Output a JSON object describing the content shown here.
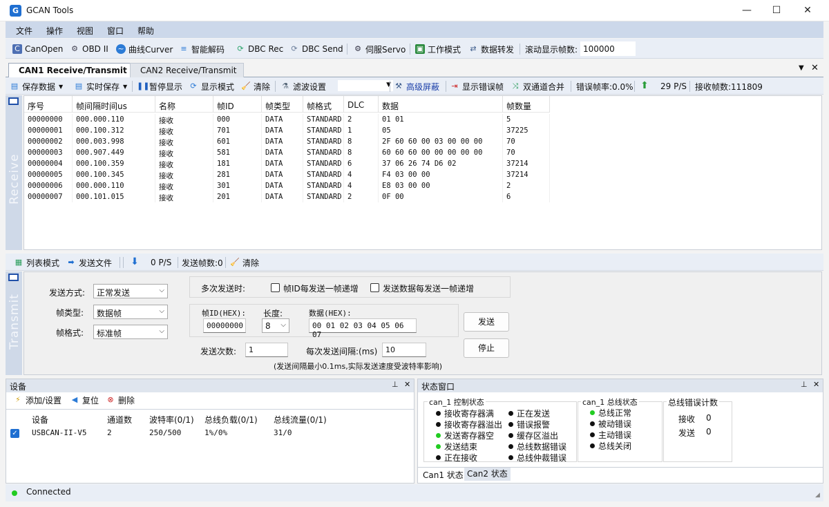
{
  "window": {
    "title": "GCAN Tools",
    "minimize": "—",
    "maximize": "☐",
    "close": "✕"
  },
  "menu": [
    "文件",
    "操作",
    "视图",
    "窗口",
    "帮助"
  ],
  "toolbar1": {
    "items": [
      "CanOpen",
      "OBD II",
      "曲线Curver",
      "智能解码",
      "DBC Rec",
      "DBC Send",
      "伺服Servo",
      "工作模式",
      "数据转发"
    ],
    "scroll_label": "滚动显示帧数:",
    "scroll_value": "100000"
  },
  "tabs": [
    "CAN1 Receive/Transmit",
    "CAN2 Receive/Transmit"
  ],
  "toolbar2": {
    "save_data": "保存数据",
    "realtime_save": "实时保存",
    "pause": "暂停显示",
    "display_mode": "显示模式",
    "clear": "清除",
    "filter_settings": "滤波设置",
    "advanced_mask": "高级屏蔽",
    "show_error_frames": "显示错误帧",
    "dual_merge": "双通道合并",
    "error_rate": "错误帧率:0.0%",
    "rate": "29 P/S",
    "received": "接收帧数:111809"
  },
  "receive": {
    "side_label": "Receive",
    "columns": [
      "序号",
      "帧间隔时间us",
      "名称",
      "帧ID",
      "帧类型",
      "帧格式",
      "DLC",
      "数据",
      "帧数量"
    ],
    "rows": [
      [
        "00000000",
        "000.000.110",
        "接收",
        "000",
        "DATA",
        "STANDARD",
        "2",
        "01 01",
        "5"
      ],
      [
        "00000001",
        "000.100.312",
        "接收",
        "701",
        "DATA",
        "STANDARD",
        "1",
        "05",
        "37225"
      ],
      [
        "00000002",
        "000.003.998",
        "接收",
        "601",
        "DATA",
        "STANDARD",
        "8",
        "2F 60 60 00 03 00 00 00",
        "70"
      ],
      [
        "00000003",
        "000.907.449",
        "接收",
        "581",
        "DATA",
        "STANDARD",
        "8",
        "60 60 60 00 00 00 00 00",
        "70"
      ],
      [
        "00000004",
        "000.100.359",
        "接收",
        "181",
        "DATA",
        "STANDARD",
        "6",
        "37 06 26 74 D6 02",
        "37214"
      ],
      [
        "00000005",
        "000.100.345",
        "接收",
        "281",
        "DATA",
        "STANDARD",
        "4",
        "F4 03 00 00",
        "37214"
      ],
      [
        "00000006",
        "000.000.110",
        "接收",
        "301",
        "DATA",
        "STANDARD",
        "4",
        "E8 03 00 00",
        "2"
      ],
      [
        "00000007",
        "000.101.015",
        "接收",
        "201",
        "DATA",
        "STANDARD",
        "2",
        "0F 00",
        "6"
      ]
    ]
  },
  "toolbar3": {
    "list_mode": "列表模式",
    "send_file": "发送文件",
    "rate": "0 P/S",
    "sent": "发送帧数:0",
    "clear": "清除"
  },
  "transmit": {
    "side_label": "Transmit",
    "send_mode_label": "发送方式:",
    "send_mode_value": "正常发送",
    "frame_type_label": "帧类型:",
    "frame_type_value": "数据帧",
    "frame_format_label": "帧格式:",
    "frame_format_value": "标准帧",
    "multi_send_label": "多次发送时:",
    "inc_id_label": "帧ID每发送一帧递增",
    "inc_data_label": "发送数据每发送一帧递增",
    "frame_id_label": "帧ID(HEX):",
    "frame_id_value": "00000000",
    "length_label": "长度:",
    "length_value": "8",
    "data_label": "数据(HEX):",
    "data_value": "00 01 02 03 04 05 06 07",
    "send_button": "发送",
    "stop_button": "停止",
    "count_label": "发送次数:",
    "count_value": "1",
    "interval_label": "每次发送间隔:(ms)",
    "interval_value": "10",
    "note": "(发送间隔最小0.1ms,实际发送速度受波特率影响)"
  },
  "device_panel": {
    "title": "设备",
    "add": "添加/设置",
    "reset": "复位",
    "delete": "删除",
    "columns": [
      "设备",
      "通道数",
      "波特率(0/1)",
      "总线负载(0/1)",
      "总线流量(0/1)"
    ],
    "row": [
      "USBCAN-II-V5",
      "2",
      "250/500",
      "1%/0%",
      "31/0"
    ]
  },
  "status_panel": {
    "title": "状态窗口",
    "ctrl_group": "can_1 控制状态",
    "ctrl_items_left": [
      "接收寄存器满",
      "接收寄存器溢出",
      "发送寄存器空",
      "发送结束",
      "正在接收"
    ],
    "ctrl_items_right": [
      "正在发送",
      "错误报警",
      "缓存区溢出",
      "总线数据错误",
      "总线仲裁错误"
    ],
    "bus_group": "can_1 总线状态",
    "bus_items": [
      "总线正常",
      "被动错误",
      "主动错误",
      "总线关闭"
    ],
    "err_group": "总线错误计数",
    "recv_label": "接收",
    "recv_value": "0",
    "send_label": "发送",
    "send_value": "0",
    "tabs": [
      "Can1 状态",
      "Can2 状态"
    ]
  },
  "status_bar": {
    "text": "Connected"
  },
  "colors": {
    "active_dot": "#22cc22",
    "inactive_dot": "#111111",
    "accent": "#1f6fd1"
  }
}
